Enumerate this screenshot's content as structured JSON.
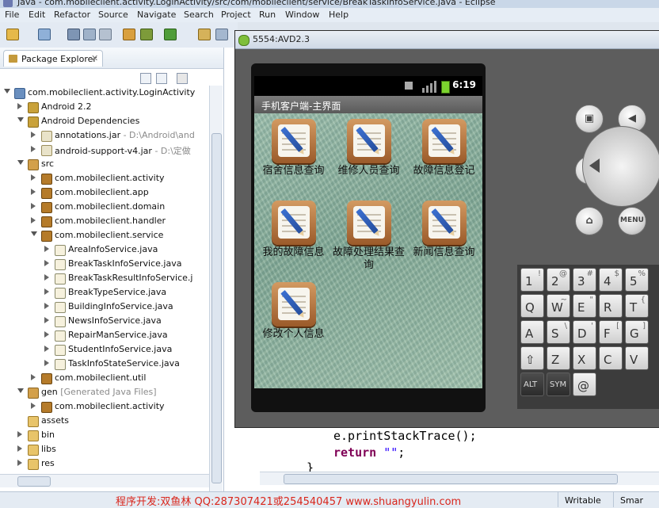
{
  "window": {
    "title": "Java - com.mobileclient.activity.LoginActivity/src/com/mobileclient/service/BreakTaskInfoService.java - Eclipse"
  },
  "menu": [
    "File",
    "Edit",
    "Refactor",
    "Source",
    "Navigate",
    "Search",
    "Project",
    "Run",
    "Window",
    "Help"
  ],
  "package_explorer": {
    "tab_label": "Package Explorer",
    "tree": [
      {
        "label": "com.mobileclient.activity.LoginActivity",
        "icon": "project-icon",
        "indent": 0,
        "state": "open"
      },
      {
        "label": "Android 2.2",
        "icon": "library-icon",
        "indent": 1,
        "state": "closed"
      },
      {
        "label": "Android Dependencies",
        "icon": "library-icon",
        "indent": 1,
        "state": "open"
      },
      {
        "label": "annotations.jar",
        "suffix": " - D:\\Android\\and",
        "icon": "jar-icon",
        "indent": 2,
        "state": "closed"
      },
      {
        "label": "android-support-v4.jar",
        "suffix": " - D:\\定做",
        "icon": "jar-icon",
        "indent": 2,
        "state": "closed"
      },
      {
        "label": "src",
        "icon": "source-folder-icon",
        "indent": 1,
        "state": "open"
      },
      {
        "label": "com.mobileclient.activity",
        "icon": "package-icon",
        "indent": 2,
        "state": "closed"
      },
      {
        "label": "com.mobileclient.app",
        "icon": "package-icon",
        "indent": 2,
        "state": "closed"
      },
      {
        "label": "com.mobileclient.domain",
        "icon": "package-icon",
        "indent": 2,
        "state": "closed"
      },
      {
        "label": "com.mobileclient.handler",
        "icon": "package-icon",
        "indent": 2,
        "state": "closed"
      },
      {
        "label": "com.mobileclient.service",
        "icon": "package-icon",
        "indent": 2,
        "state": "open"
      },
      {
        "label": "AreaInfoService.java",
        "icon": "java-file-icon",
        "indent": 3,
        "state": "closed"
      },
      {
        "label": "BreakTaskInfoService.java",
        "icon": "java-file-icon",
        "indent": 3,
        "state": "closed"
      },
      {
        "label": "BreakTaskResultInfoService.j",
        "icon": "java-file-icon",
        "indent": 3,
        "state": "closed"
      },
      {
        "label": "BreakTypeService.java",
        "icon": "java-file-icon",
        "indent": 3,
        "state": "closed"
      },
      {
        "label": "BuildingInfoService.java",
        "icon": "java-file-icon",
        "indent": 3,
        "state": "closed"
      },
      {
        "label": "NewsInfoService.java",
        "icon": "java-file-icon",
        "indent": 3,
        "state": "closed"
      },
      {
        "label": "RepairManService.java",
        "icon": "java-file-icon",
        "indent": 3,
        "state": "closed"
      },
      {
        "label": "StudentInfoService.java",
        "icon": "java-file-icon",
        "indent": 3,
        "state": "closed"
      },
      {
        "label": "TaskInfoStateService.java",
        "icon": "java-file-icon",
        "indent": 3,
        "state": "closed"
      },
      {
        "label": "com.mobileclient.util",
        "icon": "package-icon",
        "indent": 2,
        "state": "closed"
      },
      {
        "label": "gen",
        "suffix": " [Generated Java Files]",
        "icon": "source-folder-icon",
        "indent": 1,
        "state": "open"
      },
      {
        "label": "com.mobileclient.activity",
        "icon": "package-icon",
        "indent": 2,
        "state": "closed"
      },
      {
        "label": "assets",
        "icon": "folder-icon",
        "indent": 1,
        "state": "none"
      },
      {
        "label": "bin",
        "icon": "folder-icon",
        "indent": 1,
        "state": "closed"
      },
      {
        "label": "libs",
        "icon": "folder-icon",
        "indent": 1,
        "state": "closed"
      },
      {
        "label": "res",
        "icon": "folder-icon",
        "indent": 1,
        "state": "closed"
      }
    ]
  },
  "editor": {
    "lines": [
      {
        "code": "e.printStackTrace();"
      },
      {
        "keyword": "return",
        "string": "\"\"",
        "rest": ";"
      },
      {
        "code": "}"
      }
    ]
  },
  "emulator": {
    "title": "5554:AVD2.3",
    "status_time": "6:19",
    "app_title": "手机客户端-主界面",
    "grid": [
      {
        "label": "宿舍信息查询"
      },
      {
        "label": "维修人员查询"
      },
      {
        "label": "故障信息登记"
      },
      {
        "label": "我的故障信息"
      },
      {
        "label": "故障处理结果查询"
      },
      {
        "label": "新闻信息查询"
      },
      {
        "label": "修改个人信息"
      }
    ],
    "menu_button": "MENU",
    "keyboard": {
      "row1": [
        {
          "k": "1",
          "s": "!"
        },
        {
          "k": "2",
          "s": "@"
        },
        {
          "k": "3",
          "s": "#"
        },
        {
          "k": "4",
          "s": "$"
        },
        {
          "k": "5",
          "s": "%"
        }
      ],
      "row2": [
        {
          "k": "Q",
          "s": ""
        },
        {
          "k": "W",
          "s": "~"
        },
        {
          "k": "E",
          "s": "\""
        },
        {
          "k": "R",
          "s": ""
        },
        {
          "k": "T",
          "s": "{"
        }
      ],
      "row3": [
        {
          "k": "A",
          "s": ""
        },
        {
          "k": "S",
          "s": "\\"
        },
        {
          "k": "D",
          "s": "'"
        },
        {
          "k": "F",
          "s": "["
        },
        {
          "k": "G",
          "s": "]"
        }
      ],
      "row4": [
        {
          "k": "⇧",
          "s": ""
        },
        {
          "k": "Z",
          "s": ""
        },
        {
          "k": "X",
          "s": ""
        },
        {
          "k": "C",
          "s": ""
        },
        {
          "k": "V",
          "s": ""
        }
      ],
      "row5": [
        {
          "k": "ALT",
          "s": ""
        },
        {
          "k": "SYM",
          "s": ""
        },
        {
          "k": "@",
          "s": ""
        }
      ]
    }
  },
  "status_bar": {
    "watermark": "程序开发:双鱼林 QQ:287307421或254540457 www.shuangyulin.com",
    "writable": "Writable",
    "insert_mode": "Smar"
  }
}
